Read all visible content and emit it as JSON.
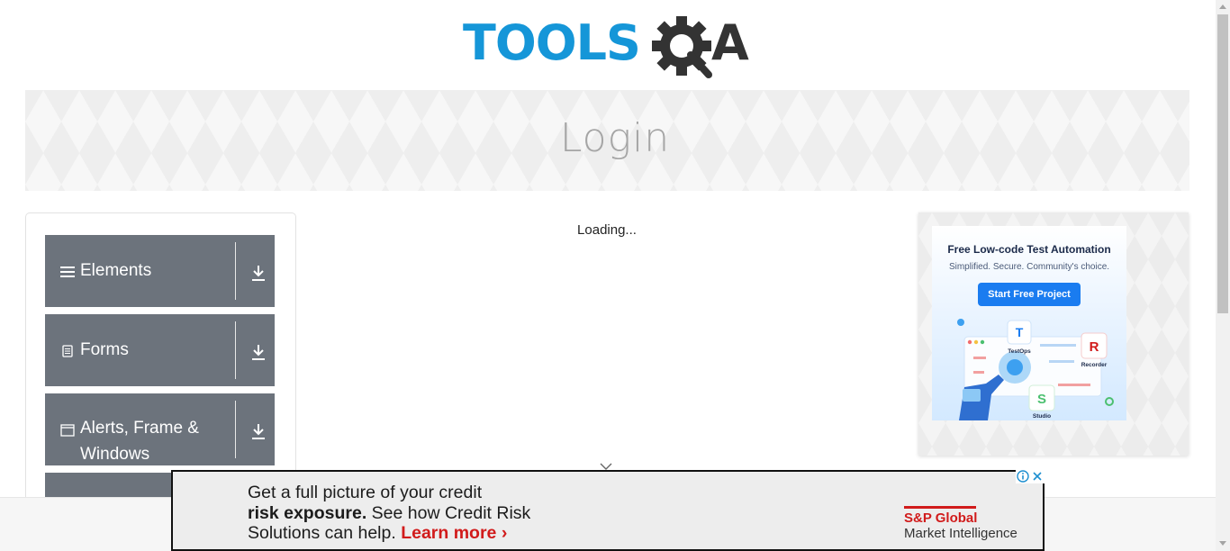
{
  "header": {
    "logo_text_left": "TOOLS",
    "logo_text_right": "QA",
    "logo_color_left": "#1596d8",
    "logo_color_right": "#333333"
  },
  "banner": {
    "title": "Login"
  },
  "sidebar": {
    "groups": [
      {
        "icon": "hamburger-icon",
        "label": "Elements"
      },
      {
        "icon": "document-icon",
        "label": "Forms"
      },
      {
        "icon": "window-icon",
        "label_line1": "Alerts, Frame &",
        "label_line2": "Windows"
      },
      {
        "icon": "",
        "label": ""
      }
    ],
    "group_bg": "#6c737c"
  },
  "main": {
    "loading_text": "Loading..."
  },
  "right_ad": {
    "headline": "Free Low-code Test Automation",
    "subline": "Simplified. Secure. Community's choice.",
    "button": "Start Free Project",
    "labels": {
      "testops": "TestOps",
      "recorder": "Recorder",
      "studio": "Studio"
    },
    "accent": "#1a7cf0"
  },
  "bottom_ad": {
    "line1": "Get a full picture of your credit",
    "line2_bold": "risk exposure.",
    "line2_rest": " See how Credit Risk",
    "line3": "Solutions can help. ",
    "learn_more": "Learn more ›",
    "brand_line1": "S&P Global",
    "brand_line2": "Market Intelligence",
    "brand_color": "#d11b1b"
  }
}
